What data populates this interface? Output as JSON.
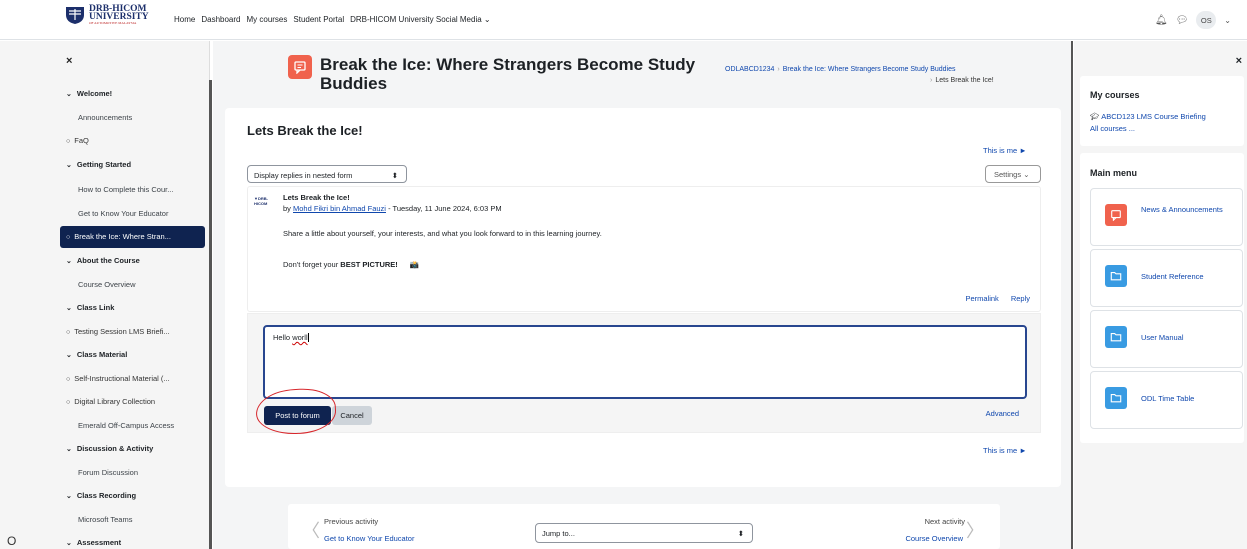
{
  "topbar": {
    "logo_line1": "DRB-HICOM",
    "logo_line2": "UNIVERSITY",
    "logo_line3": "OF AUTOMOTIVE MALAYSIA",
    "nav": [
      "Home",
      "Dashboard",
      "My courses",
      "Student Portal",
      "DRB-HICOM University Social Media"
    ],
    "avatar_initials": "OS"
  },
  "course_index": [
    {
      "label": "Welcome!",
      "kind": "section"
    },
    {
      "label": "Announcements",
      "kind": "sub"
    },
    {
      "label": "FaQ",
      "kind": "circle"
    },
    {
      "label": "Getting Started",
      "kind": "section"
    },
    {
      "label": "How to Complete this Cour...",
      "kind": "sub"
    },
    {
      "label": "Get to Know Your Educator",
      "kind": "sub"
    },
    {
      "label": "Break the Ice: Where Stran...",
      "kind": "active"
    },
    {
      "label": "About the Course",
      "kind": "section"
    },
    {
      "label": "Course Overview",
      "kind": "sub"
    },
    {
      "label": "Class Link",
      "kind": "section"
    },
    {
      "label": "Testing Session LMS Briefi...",
      "kind": "circle"
    },
    {
      "label": "Class Material",
      "kind": "section"
    },
    {
      "label": "Self-Instructional Material (...",
      "kind": "circle"
    },
    {
      "label": "Digital Library Collection",
      "kind": "circle"
    },
    {
      "label": "Emerald Off-Campus Access",
      "kind": "sub"
    },
    {
      "label": "Discussion & Activity",
      "kind": "section"
    },
    {
      "label": "Forum Discussion",
      "kind": "sub"
    },
    {
      "label": "Class Recording",
      "kind": "section"
    },
    {
      "label": "Microsoft Teams",
      "kind": "sub"
    },
    {
      "label": "Assessment",
      "kind": "section"
    }
  ],
  "page": {
    "title": "Break the Ice: Where Strangers Become Study Buddies",
    "breadcrumb": [
      "ODLABCD1234",
      "Break the Ice: Where Strangers Become Study Buddies",
      "Lets Break the Ice!"
    ]
  },
  "discussion": {
    "title": "Lets Break the Ice!",
    "this_is_me": "This is me ►",
    "display_mode": "Display replies in nested form",
    "settings_label": "Settings",
    "post": {
      "subject": "Lets Break the Ice!",
      "by": "by",
      "author": "Mohd Fikri bin Ahmad Fauzi",
      "date": " - Tuesday, 11 June 2024, 6:03 PM",
      "body": "Share a little about yourself, your interests, and what you look forward to in this learning journey.",
      "reminder_prefix": "Don't forget your ",
      "reminder_bold": "BEST PICTURE!",
      "permalink": "Permalink",
      "reply": "Reply"
    },
    "reply": {
      "text_plain": "Hello ",
      "text_misspelled": "worll",
      "post_button": "Post to forum",
      "cancel_button": "Cancel",
      "advanced": "Advanced"
    }
  },
  "activity_nav": {
    "previous_label": "Previous activity",
    "previous_link": "Get to Know Your Educator",
    "jump_placeholder": "Jump to...",
    "next_label": "Next activity",
    "next_link": "Course Overview"
  },
  "right_drawer": {
    "my_courses_title": "My courses",
    "course_link": "ABCD123 LMS Course Briefing",
    "all_courses": "All courses ...",
    "main_menu_title": "Main menu",
    "menu_items": [
      {
        "label": "News & Announcements",
        "color": "#f0624d",
        "icon": "forum-icon"
      },
      {
        "label": "Student Reference",
        "color": "#399be2",
        "icon": "folder-icon"
      },
      {
        "label": "User Manual",
        "color": "#399be2",
        "icon": "folder-icon"
      },
      {
        "label": "ODL Time Table",
        "color": "#399be2",
        "icon": "folder-icon"
      }
    ]
  },
  "stray_glyph": "O",
  "colors": {
    "primary": "#0f2350",
    "link": "#0f47ad",
    "forum": "#f0624d",
    "folder": "#399be2",
    "annotation": "#d7262b"
  }
}
